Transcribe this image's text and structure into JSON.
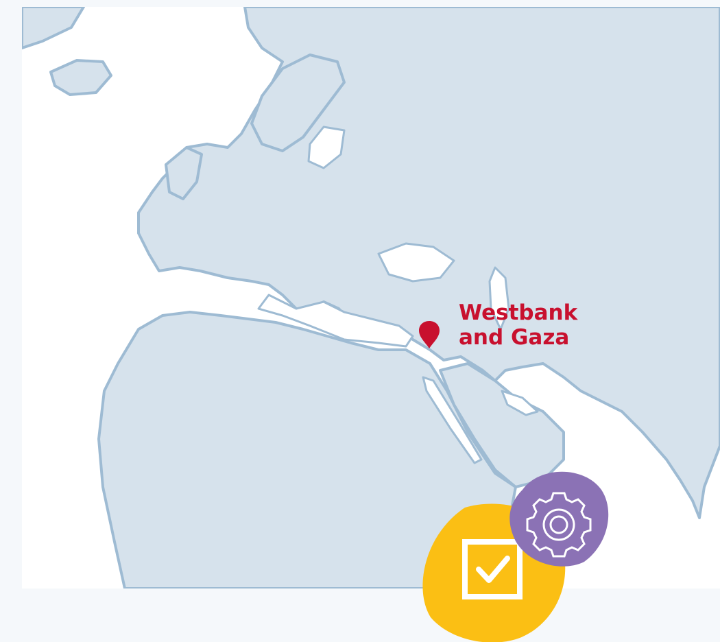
{
  "marker": {
    "label_line1": "Westbank",
    "label_line2": "and Gaza"
  },
  "colors": {
    "land": "#d6e2ec",
    "coast": "#9ebbd3",
    "marker": "#c8102e",
    "badge_yellow": "#fbbf14",
    "badge_purple": "#8b72b5"
  },
  "badges": [
    {
      "icon": "checkbox-checked-icon"
    },
    {
      "icon": "gear-icon"
    }
  ]
}
